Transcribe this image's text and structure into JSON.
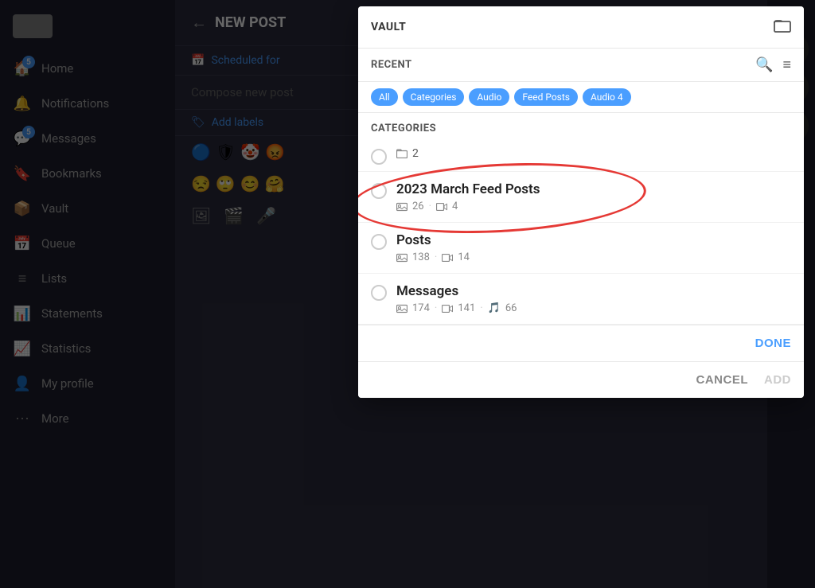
{
  "sidebar": {
    "logo_alt": "Logo",
    "items": [
      {
        "id": "home",
        "label": "Home",
        "icon": "🏠",
        "badge": "5",
        "has_badge": true
      },
      {
        "id": "notifications",
        "label": "Notifications",
        "icon": "🔔",
        "has_badge": false
      },
      {
        "id": "messages",
        "label": "Messages",
        "icon": "💬",
        "badge": "5",
        "has_badge": true
      },
      {
        "id": "bookmarks",
        "label": "Bookmarks",
        "icon": "🔖",
        "has_badge": false
      },
      {
        "id": "vault",
        "label": "Vault",
        "icon": "📦",
        "has_badge": false
      },
      {
        "id": "queue",
        "label": "Queue",
        "icon": "📅",
        "has_badge": false
      },
      {
        "id": "lists",
        "label": "Lists",
        "icon": "≡",
        "has_badge": false
      },
      {
        "id": "statements",
        "label": "Statements",
        "icon": "📊",
        "has_badge": false
      },
      {
        "id": "statistics",
        "label": "Statistics",
        "icon": "📈",
        "has_badge": false
      },
      {
        "id": "my-profile",
        "label": "My profile",
        "icon": "👤",
        "has_badge": false
      },
      {
        "id": "more",
        "label": "More",
        "icon": "⋯",
        "has_badge": false
      }
    ]
  },
  "main": {
    "header_title": "NEW POST",
    "back_label": "←",
    "scheduled_label": "Scheduled for",
    "compose_placeholder": "Compose new post",
    "add_labels": "Add labels"
  },
  "modal": {
    "vault_title": "VAULT",
    "vault_icon": "⬜",
    "recent_label": "RECENT",
    "search_icon": "🔍",
    "filter_icon": "≡",
    "recent_chips": [
      "All",
      "Categories",
      "Audio",
      "Feed Posts",
      "Audio 4"
    ],
    "categories_label": "CATEGORIES",
    "categories": [
      {
        "id": "folder-2",
        "name": "2",
        "has_name": false,
        "icon": "folder",
        "count_only": true,
        "photo_count": null,
        "video_count": null,
        "show_simple": true
      },
      {
        "id": "2023-march-feed-posts",
        "name": "2023 March Feed Posts",
        "photo_count": "26",
        "video_count": "4",
        "has_audio": false,
        "selected": false
      },
      {
        "id": "posts",
        "name": "Posts",
        "photo_count": "138",
        "video_count": "14",
        "has_audio": false,
        "selected": false
      },
      {
        "id": "messages",
        "name": "Messages",
        "photo_count": "174",
        "video_count": "141",
        "audio_count": "66",
        "has_audio": true,
        "selected": false
      }
    ],
    "done_label": "DONE",
    "cancel_label": "CANCEL",
    "add_label": "ADD"
  }
}
